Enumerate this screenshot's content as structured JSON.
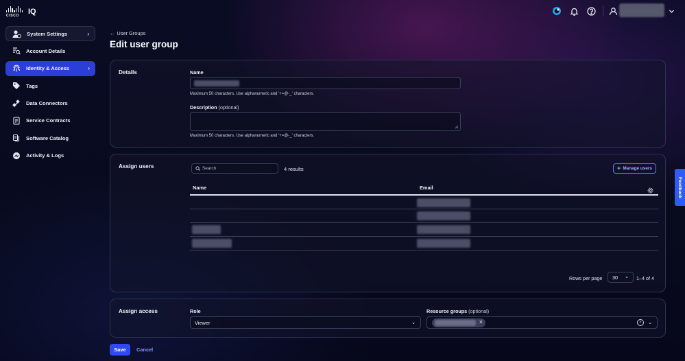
{
  "app": {
    "brand": "CISCO",
    "product": "IQ"
  },
  "sidebar": {
    "items": [
      {
        "label": "System Settings",
        "icon": "user-gear-icon"
      },
      {
        "label": "Account Details",
        "icon": "account-search-icon"
      },
      {
        "label": "Identity & Access",
        "icon": "fingerprint-icon"
      },
      {
        "label": "Tags",
        "icon": "tag-icon"
      },
      {
        "label": "Data Connectors",
        "icon": "connector-icon"
      },
      {
        "label": "Service Contracts",
        "icon": "contract-icon"
      },
      {
        "label": "Software Catalog",
        "icon": "catalog-icon"
      },
      {
        "label": "Activity & Logs",
        "icon": "activity-icon"
      }
    ]
  },
  "header": {
    "breadcrumb": "User Groups",
    "title": "Edit user group"
  },
  "details": {
    "title": "Details",
    "name_label": "Name",
    "name_help": "Maximum 50 characters. Use alphanumeric and '+=@-_' characters.",
    "description_label": "Description",
    "description_optional": "(optional)",
    "description_help": "Maximum 50 characters. Use alphanumeric and '+=@-_' characters."
  },
  "assign_users": {
    "title": "Assign users",
    "search_placeholder": "Search",
    "results": "4 results",
    "manage_label": "Manage users",
    "columns": [
      "Name",
      "Email"
    ],
    "rows_per_page_label": "Rows per page",
    "rows_per_page_value": "30",
    "pager": "1–4 of 4"
  },
  "assign_access": {
    "title": "Assign access",
    "role_label": "Role",
    "role_value": "Viewer",
    "resource_label": "Resource groups",
    "resource_optional": "(optional)"
  },
  "footer": {
    "save_label": "Save",
    "cancel_label": "Cancel"
  },
  "feedback": {
    "label": "Feedback"
  },
  "colors": {
    "accent": "#2f4bf0",
    "active_nav": "#2b3fd6",
    "link": "#7f96ff"
  }
}
